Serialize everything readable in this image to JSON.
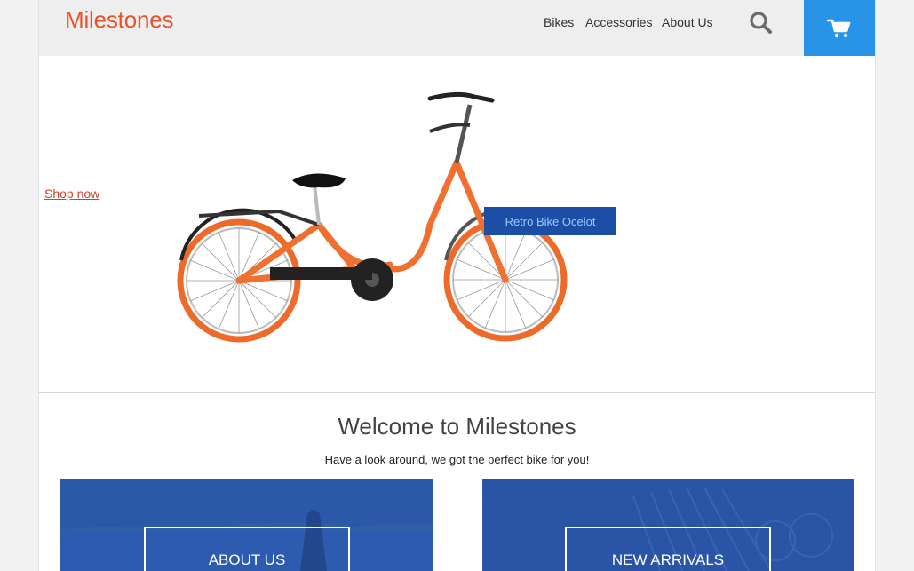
{
  "brand": {
    "name": "Milestones",
    "color": "#e8522b"
  },
  "nav": {
    "items": [
      "Bikes",
      "Accessories",
      "About Us"
    ]
  },
  "icons": {
    "search": "search-icon",
    "cart": "cart-icon"
  },
  "hero": {
    "shop_link": "Shop now ",
    "product_tag": "Retro Bike Ocelot"
  },
  "welcome": {
    "title": "Welcome to Milestones",
    "subtitle": "Have a look around, we got the perfect bike for you!"
  },
  "tiles": [
    {
      "label": "ABOUT US"
    },
    {
      "label": "NEW ARRIVALS"
    }
  ],
  "colors": {
    "accent": "#2794e8",
    "tile": "#2a56a8",
    "tag": "#1d4ea6"
  }
}
